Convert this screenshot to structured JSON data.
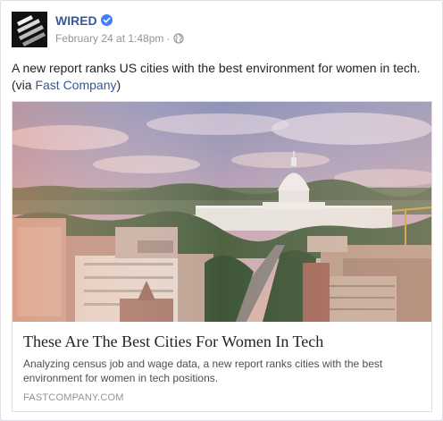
{
  "post": {
    "page_name": "WIRED",
    "timestamp": "February 24 at 1:48pm",
    "separator": "·",
    "message_text": "A new report ranks US cities with the best environment for women in tech. (via ",
    "message_link": "Fast Company",
    "message_end": ")"
  },
  "link_card": {
    "title": "These Are The Best Cities For Women In Tech",
    "description": "Analyzing census job and wage data, a new report ranks cities with the best environment for women in tech positions.",
    "source": "FASTCOMPANY.COM"
  },
  "icons": {
    "verified": "verified-badge-icon",
    "audience": "globe-icon"
  },
  "colors": {
    "link": "#365899",
    "verified": "#4080ff",
    "meta": "#90949c"
  }
}
